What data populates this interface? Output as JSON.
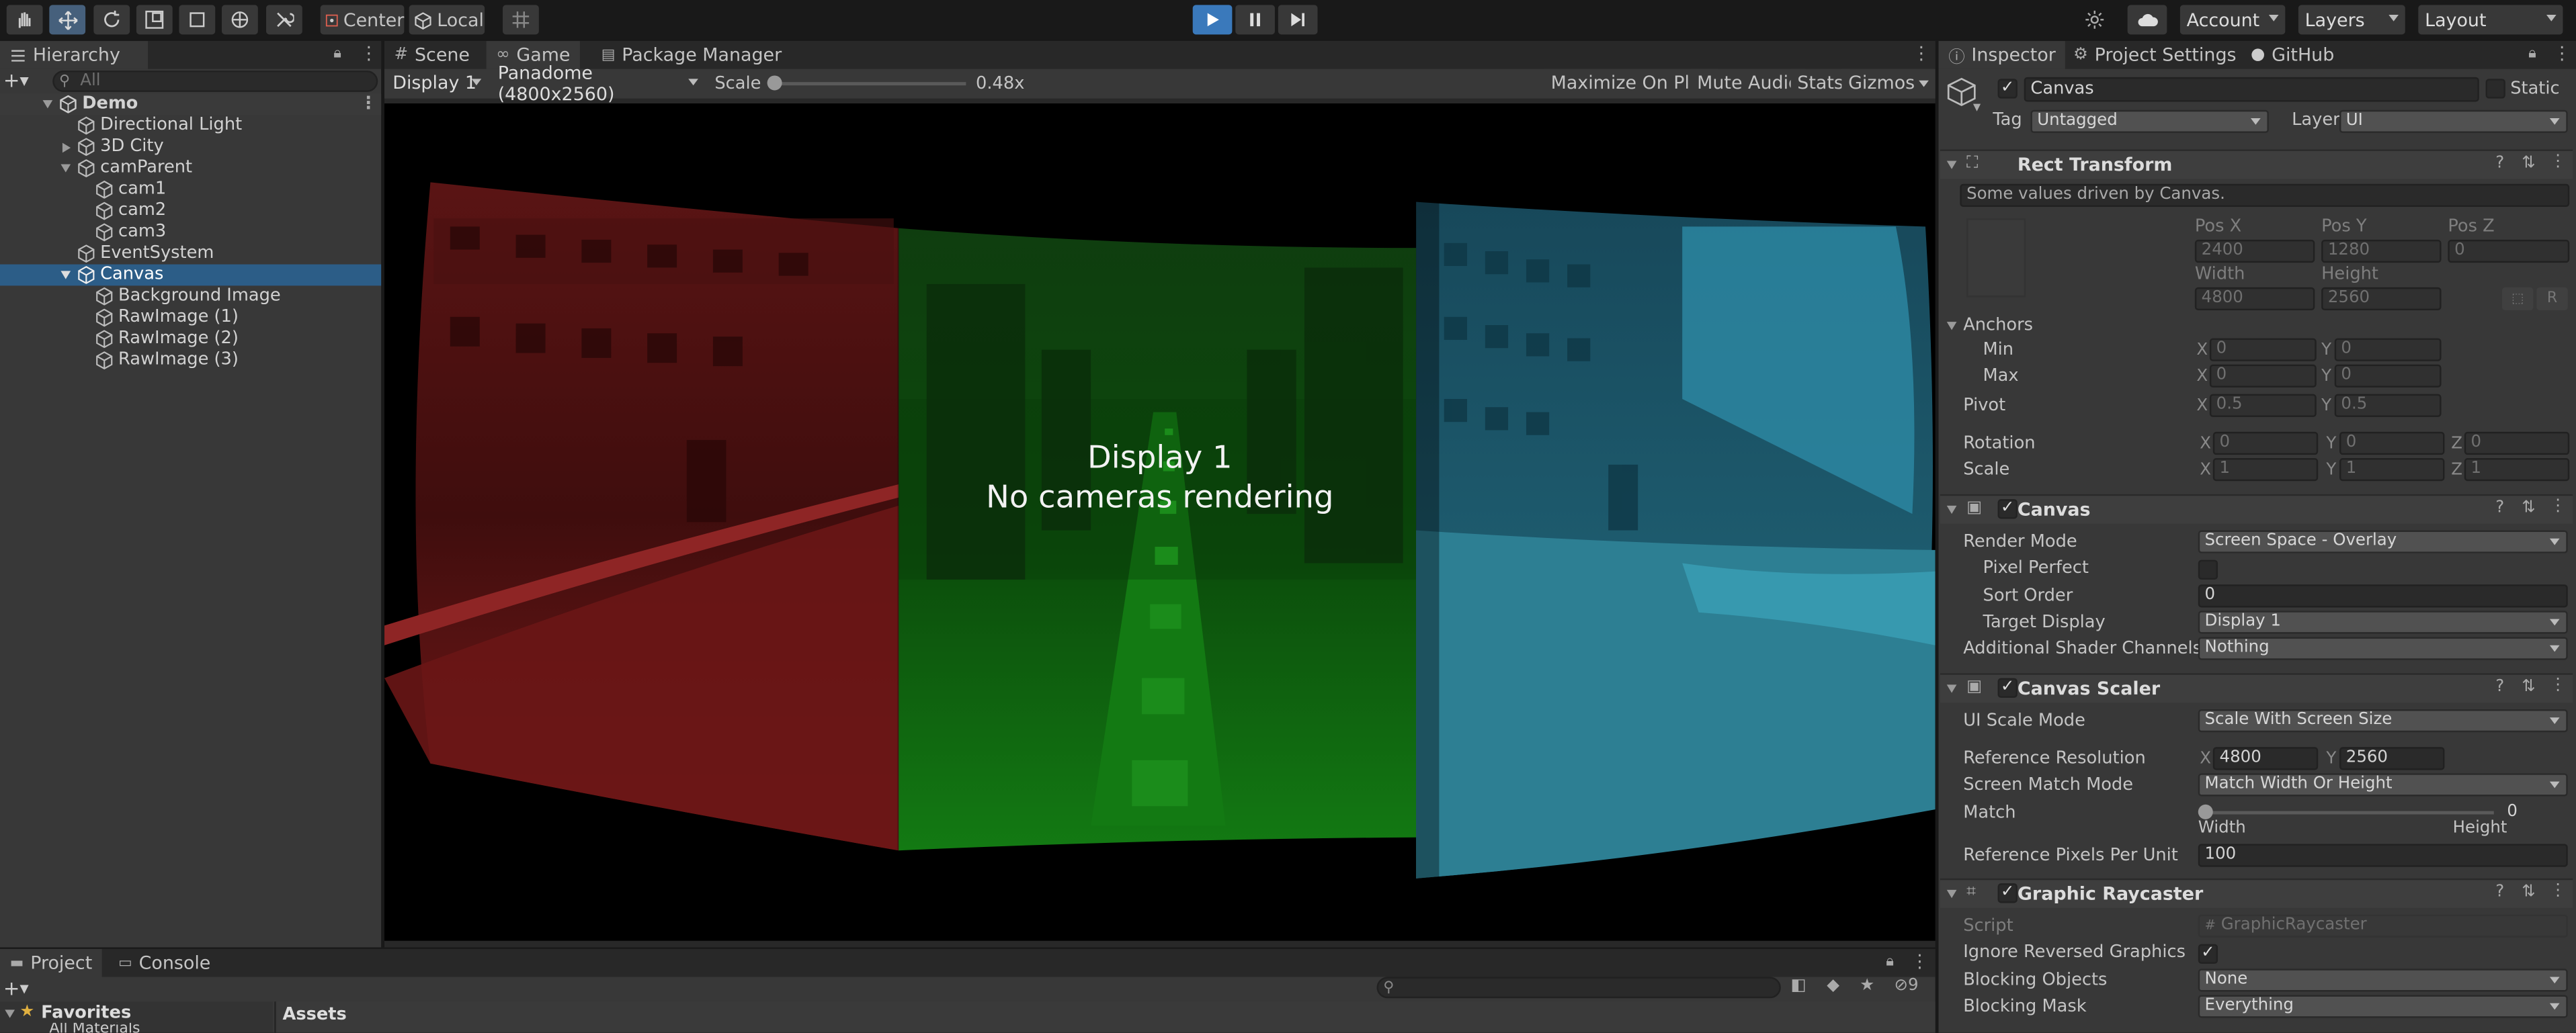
{
  "toolbar": {
    "center": "Center",
    "local": "Local",
    "account": "Account",
    "layers": "Layers",
    "layout": "Layout"
  },
  "hierarchy": {
    "tab": "Hierarchy",
    "search_placeholder": "All",
    "items": [
      "Demo",
      "Directional Light",
      "3D City",
      "camParent",
      "cam1",
      "cam2",
      "cam3",
      "EventSystem",
      "Canvas",
      "Background Image",
      "RawImage (1)",
      "RawImage (2)",
      "RawImage (3)"
    ]
  },
  "scene_tabs": {
    "scene": "Scene",
    "game": "Game",
    "package_manager": "Package Manager"
  },
  "game_bar": {
    "display": "Display 1",
    "aspect": "Panadome (4800x2560)",
    "scale_label": "Scale",
    "scale_value": "0.48x",
    "maximize": "Maximize On Play",
    "mute": "Mute Audio",
    "stats": "Stats",
    "gizmos": "Gizmos"
  },
  "game_view": {
    "line1": "Display 1",
    "line2": "No cameras rendering"
  },
  "bottom": {
    "project": "Project",
    "console": "Console",
    "favorites": "Favorites",
    "all_materials": "All Materials",
    "assets": "Assets",
    "hidden_count": "9"
  },
  "inspector": {
    "tabs": {
      "inspector": "Inspector",
      "project_settings": "Project Settings",
      "github": "GitHub"
    },
    "object": {
      "name": "Canvas",
      "static": "Static",
      "tag_label": "Tag",
      "tag": "Untagged",
      "layer_label": "Layer",
      "layer": "UI"
    },
    "rect_transform": {
      "title": "Rect Transform",
      "note": "Some values driven by Canvas.",
      "pos_x_label": "Pos X",
      "pos_y_label": "Pos Y",
      "pos_z_label": "Pos Z",
      "pos_x": "2400",
      "pos_y": "1280",
      "pos_z": "0",
      "width_label": "Width",
      "height_label": "Height",
      "width": "4800",
      "height": "2560",
      "anchors": "Anchors",
      "min": "Min",
      "max": "Max",
      "min_x": "0",
      "min_y": "0",
      "max_x": "0",
      "max_y": "0",
      "pivot": "Pivot",
      "pivot_x": "0.5",
      "pivot_y": "0.5",
      "rotation": "Rotation",
      "rot_x": "0",
      "rot_y": "0",
      "rot_z": "0",
      "scale": "Scale",
      "scale_x": "1",
      "scale_y": "1",
      "scale_z": "1",
      "r": "R"
    },
    "canvas": {
      "title": "Canvas",
      "render_mode_label": "Render Mode",
      "render_mode": "Screen Space - Overlay",
      "pixel_perfect": "Pixel Perfect",
      "sort_order_label": "Sort Order",
      "sort_order": "0",
      "target_display_label": "Target Display",
      "target_display": "Display 1",
      "shader_channels_label": "Additional Shader Channels",
      "shader_channels": "Nothing"
    },
    "canvas_scaler": {
      "title": "Canvas Scaler",
      "ui_scale_mode_label": "UI Scale Mode",
      "ui_scale_mode": "Scale With Screen Size",
      "ref_res_label": "Reference Resolution",
      "ref_x": "4800",
      "ref_y": "2560",
      "match_mode_label": "Screen Match Mode",
      "match_mode": "Match Width Or Height",
      "match_label": "Match",
      "match_value": "0",
      "match_fraction": 0,
      "width": "Width",
      "height": "Height",
      "ppu_label": "Reference Pixels Per Unit",
      "ppu": "100"
    },
    "graphic_raycaster": {
      "title": "Graphic Raycaster",
      "script_label": "Script",
      "script": "GraphicRaycaster",
      "ignore_reversed": "Ignore Reversed Graphics",
      "blocking_objects_label": "Blocking Objects",
      "blocking_objects": "None",
      "blocking_mask_label": "Blocking Mask",
      "blocking_mask": "Everything"
    }
  },
  "colors": {
    "selection": "#2c5d87",
    "play_active": "#3a79bb",
    "panel": "#383838",
    "red_view": "#8a1f1f",
    "green_view": "#1f8f1f",
    "teal_view": "#2a8aa0"
  }
}
